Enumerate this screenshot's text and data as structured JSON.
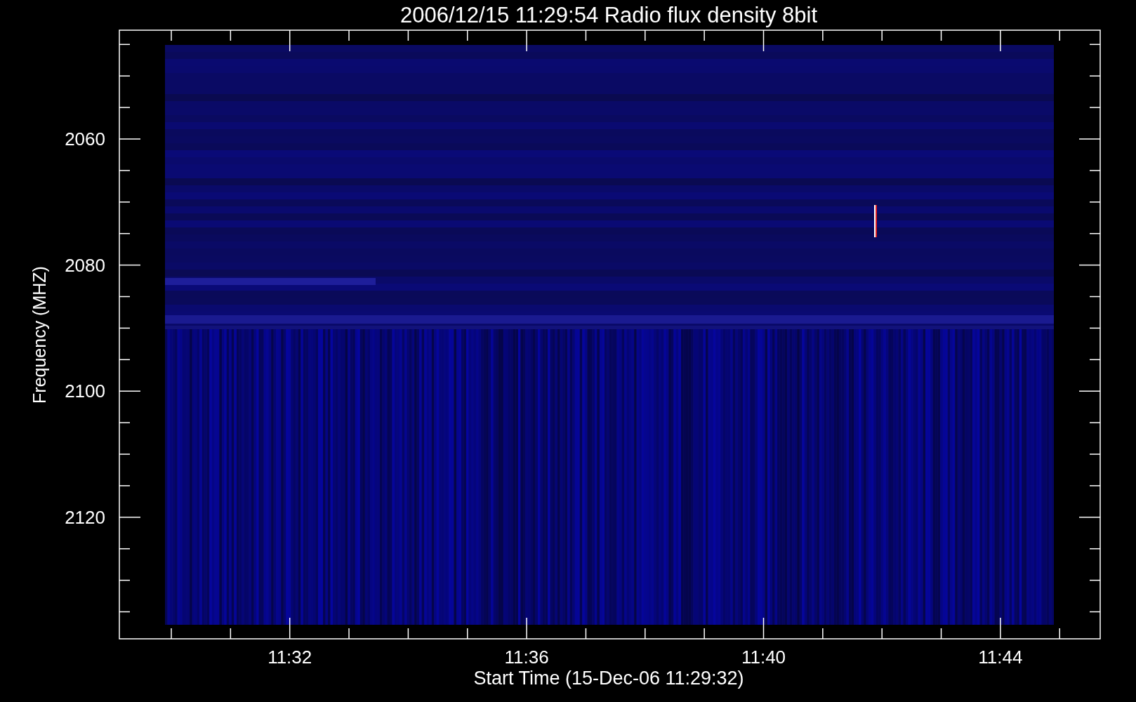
{
  "plot": {
    "title": "2006/12/15 11:29:54 Radio flux density 8bit",
    "ylabel": "Frequency (MHZ)",
    "xlabel": "Start Time (15-Dec-06 11:29:32)",
    "yticks": [
      "2060",
      "2080",
      "2100",
      "2120"
    ],
    "xticks": [
      "11:32",
      "11:36",
      "11:40",
      "11:44"
    ]
  }
}
